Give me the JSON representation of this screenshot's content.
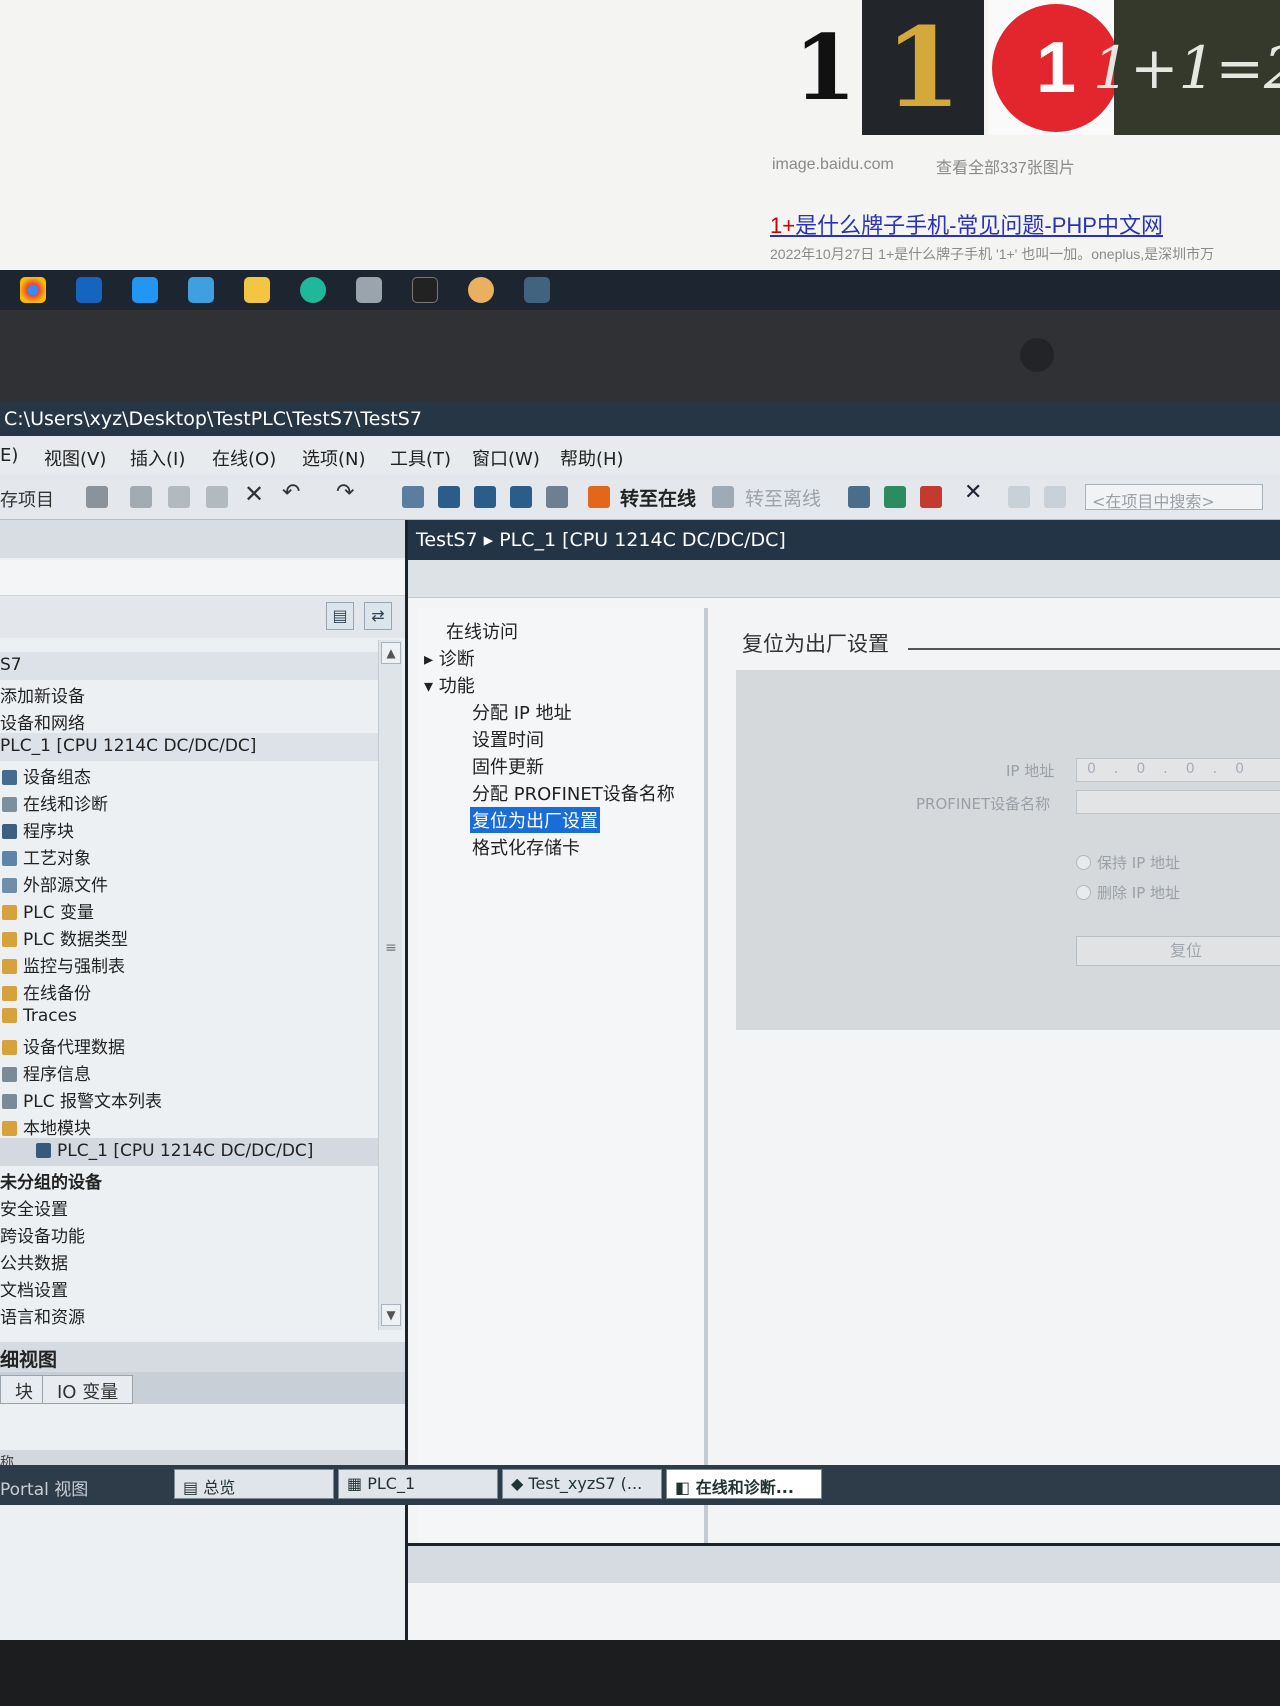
{
  "browser": {
    "thumb_numeral": "1",
    "thumb_gold": "1",
    "thumb_red": "1",
    "thumb_formula": "1+1=2",
    "image_source": "image.baidu.com",
    "view_all": "查看全部337张图片",
    "result_prefix": "1+",
    "result_title": "是什么牌子手机-常见问题-PHP中文网",
    "result_desc": "2022年10月27日 1+是什么牌子手机 '1+' 也叫一加。oneplus,是深圳市万"
  },
  "taskbar": {
    "icons": [
      "chrome-icon",
      "terminal-icon",
      "vscode-icon",
      "app-icon",
      "folder-icon",
      "edge-icon",
      "app2-icon",
      "cmd-icon",
      "paint-icon",
      "tia-icon"
    ]
  },
  "window": {
    "title": "C:\\Users\\xyz\\Desktop\\TestPLC\\TestS7\\TestS7"
  },
  "menu": [
    "E)",
    "视图(V)",
    "插入(I)",
    "在线(O)",
    "选项(N)",
    "工具(T)",
    "窗口(W)",
    "帮助(H)"
  ],
  "toolbar": {
    "save_project": "存项目",
    "go_online": "转至在线",
    "go_offline": "转至离线",
    "search_placeholder": "<在项目中搜索>"
  },
  "tree": {
    "items": [
      {
        "label": "S7",
        "indent": 0
      },
      {
        "label": "添加新设备",
        "indent": 0
      },
      {
        "label": "设备和网络",
        "indent": 0
      },
      {
        "label": "PLC_1 [CPU 1214C DC/DC/DC]",
        "indent": 0
      },
      {
        "label": "设备组态",
        "indent": 1
      },
      {
        "label": "在线和诊断",
        "indent": 1
      },
      {
        "label": "程序块",
        "indent": 1
      },
      {
        "label": "工艺对象",
        "indent": 1
      },
      {
        "label": "外部源文件",
        "indent": 1
      },
      {
        "label": "PLC 变量",
        "indent": 1
      },
      {
        "label": "PLC 数据类型",
        "indent": 1
      },
      {
        "label": "监控与强制表",
        "indent": 1
      },
      {
        "label": "在线备份",
        "indent": 1
      },
      {
        "label": "Traces",
        "indent": 1
      },
      {
        "label": "设备代理数据",
        "indent": 1
      },
      {
        "label": "程序信息",
        "indent": 1
      },
      {
        "label": "PLC 报警文本列表",
        "indent": 1
      },
      {
        "label": "本地模块",
        "indent": 1
      },
      {
        "label": "PLC_1 [CPU 1214C DC/DC/DC]",
        "indent": 2
      },
      {
        "label": "未分组的设备",
        "indent": 0
      },
      {
        "label": "安全设置",
        "indent": 0
      },
      {
        "label": "跨设备功能",
        "indent": 0
      },
      {
        "label": "公共数据",
        "indent": 0
      },
      {
        "label": "文档设置",
        "indent": 0
      },
      {
        "label": "语言和资源",
        "indent": 0
      }
    ]
  },
  "details": {
    "title": "细视图",
    "tab1": "块",
    "tab2": "IO 变量",
    "col_name": "称"
  },
  "editor": {
    "breadcrumb_project": "TestS7",
    "breadcrumb_device": "PLC_1 [CPU 1214C DC/DC/DC]",
    "nav": {
      "online_access": "在线访问",
      "diagnostics": "诊断",
      "functions": "功能",
      "assign_ip": "分配 IP 地址",
      "set_time": "设置时间",
      "firmware_update": "固件更新",
      "assign_profinet": "分配 PROFINET设备名称",
      "reset_factory": "复位为出厂设置",
      "format_card": "格式化存储卡"
    },
    "section_title": "复位为出厂设置",
    "ip_label": "IP 地址",
    "ip_values": [
      "0",
      "0",
      "0",
      "0"
    ],
    "profinet_label": "PROFINET设备名称",
    "keep_ip": "保持 IP 地址",
    "delete_ip": "删除 IP 地址",
    "reset_button": "复位"
  },
  "statusbar": {
    "portal_view": "Portal 视图",
    "tasks": [
      "总览",
      "PLC_1",
      "Test_xyzS7 (...",
      "在线和诊断..."
    ]
  }
}
